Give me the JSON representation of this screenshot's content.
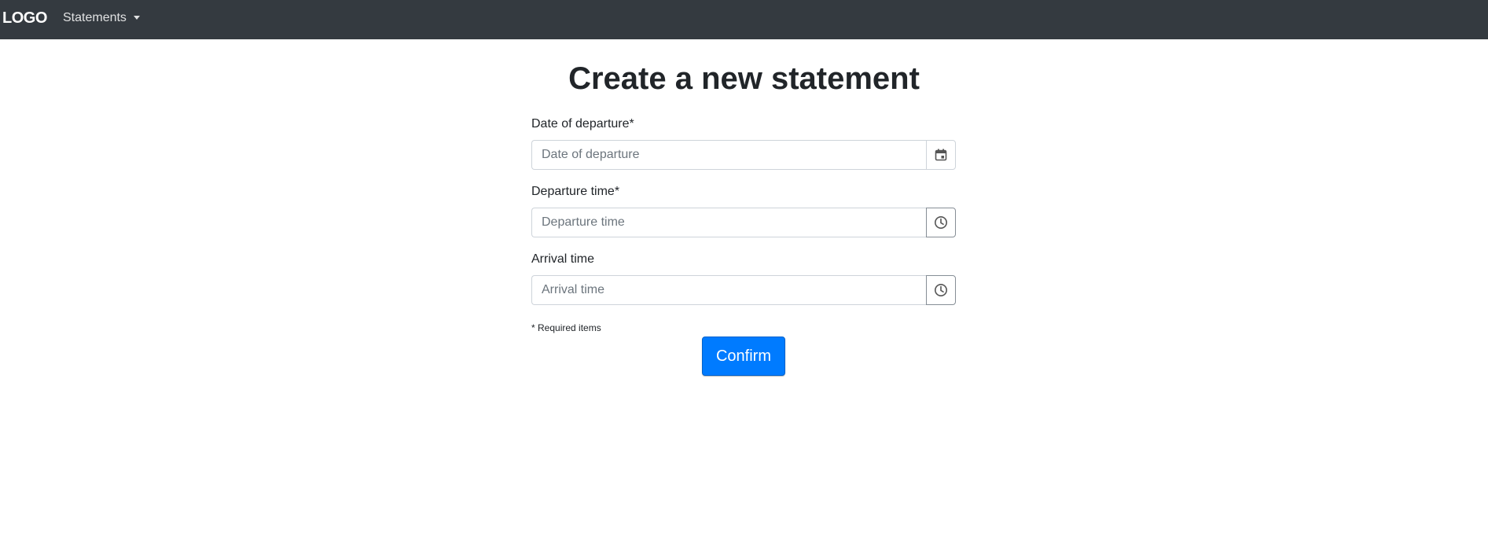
{
  "navbar": {
    "brand": "LOGO",
    "menu_label": "Statements",
    "background": "#343a40"
  },
  "page": {
    "title": "Create a new statement"
  },
  "form": {
    "fields": [
      {
        "label": "Date of departure*",
        "placeholder": "Date of departure",
        "value": "",
        "icon": "calendar-icon"
      },
      {
        "label": "Departure time*",
        "placeholder": "Departure time",
        "value": "",
        "icon": "clock-icon"
      },
      {
        "label": "Arrival time",
        "placeholder": "Arrival time",
        "value": "",
        "icon": "clock-icon"
      }
    ],
    "required_note": "* Required items",
    "confirm_label": "Confirm",
    "accent": "#007bff"
  }
}
